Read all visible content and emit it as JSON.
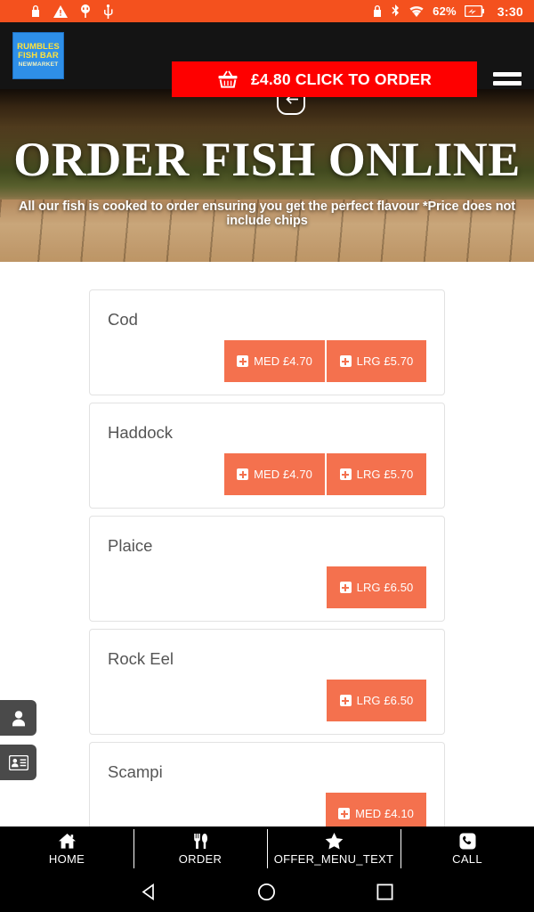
{
  "status_bar": {
    "left_icons": [
      "lock-icon",
      "warning-icon",
      "plug-icon",
      "usb-icon"
    ],
    "right_icons": [
      "lock-icon",
      "bluetooth-icon",
      "wifi-icon"
    ],
    "battery_percent": "62%",
    "battery_icon": "battery-charging-icon",
    "time": "3:30",
    "background_color": "#F4511E"
  },
  "header": {
    "logo": {
      "line1": "RUMBLES",
      "line2": "FISH BAR",
      "line3": "NEWMARKET",
      "background_color": "#2E8FE8",
      "text_color": "#FFE23D"
    },
    "order_button": {
      "icon": "basket-icon",
      "label": "£4.80 CLICK TO ORDER",
      "background_color": "#FE0000"
    },
    "menu_icon": "hamburger-icon",
    "background_color": "#141414"
  },
  "hero": {
    "back_icon": "arrow-left-icon",
    "title": "ORDER FISH ONLINE",
    "subtitle": "All our fish is cooked to order ensuring you get the perfect flavour *Price does not include chips"
  },
  "menu": {
    "accent_color": "#F4714E",
    "items": [
      {
        "name": "Cod",
        "options": [
          {
            "size": "MED",
            "price": "£4.70",
            "label": "MED £4.70"
          },
          {
            "size": "LRG",
            "price": "£5.70",
            "label": "LRG £5.70"
          }
        ]
      },
      {
        "name": "Haddock",
        "options": [
          {
            "size": "MED",
            "price": "£4.70",
            "label": "MED £4.70"
          },
          {
            "size": "LRG",
            "price": "£5.70",
            "label": "LRG £5.70"
          }
        ]
      },
      {
        "name": "Plaice",
        "options": [
          {
            "size": "LRG",
            "price": "£6.50",
            "label": "LRG £6.50"
          }
        ]
      },
      {
        "name": "Rock Eel",
        "options": [
          {
            "size": "LRG",
            "price": "£6.50",
            "label": "LRG £6.50"
          }
        ]
      },
      {
        "name": "Scampi",
        "options": [
          {
            "size": "MED",
            "price": "£4.10",
            "label": "MED £4.10"
          }
        ]
      }
    ]
  },
  "side_tabs": [
    {
      "icon": "user-icon"
    },
    {
      "icon": "contact-card-icon"
    }
  ],
  "bottom_nav": {
    "items": [
      {
        "icon": "home-icon",
        "label": "HOME"
      },
      {
        "icon": "cutlery-icon",
        "label": "ORDER"
      },
      {
        "icon": "star-icon",
        "label": "OFFER_MENU_TEXT"
      },
      {
        "icon": "phone-icon",
        "label": "CALL"
      }
    ]
  },
  "system_bar": {
    "buttons": [
      {
        "icon": "back-triangle-icon"
      },
      {
        "icon": "home-circle-icon"
      },
      {
        "icon": "recents-square-icon"
      }
    ]
  }
}
